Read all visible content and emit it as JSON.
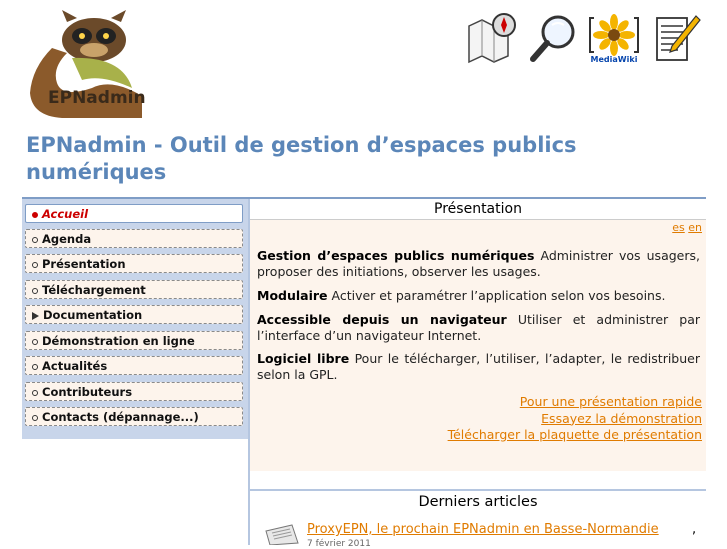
{
  "header": {
    "logo_text": "EPNadmin",
    "icons": [
      "map-compass-icon",
      "magnifier-icon",
      "mediawiki-icon",
      "notepad-pencil-icon"
    ],
    "mediawiki_label": "MediaWiki"
  },
  "page": {
    "title": "EPNadmin - Outil de gestion d’espaces publics numériques"
  },
  "sidebar": {
    "items": [
      {
        "label": "Accueil",
        "active": true,
        "marker": "bullet"
      },
      {
        "label": "Agenda",
        "active": false,
        "marker": "bullet"
      },
      {
        "label": "Présentation",
        "active": false,
        "marker": "bullet"
      },
      {
        "label": "Téléchargement",
        "active": false,
        "marker": "bullet"
      },
      {
        "label": "Documentation",
        "active": false,
        "marker": "triangle"
      },
      {
        "label": "Démonstration en ligne",
        "active": false,
        "marker": "bullet"
      },
      {
        "label": "Actualités",
        "active": false,
        "marker": "bullet"
      },
      {
        "label": "Contributeurs",
        "active": false,
        "marker": "bullet"
      },
      {
        "label": "Contacts (dépannage...)",
        "active": false,
        "marker": "bullet"
      }
    ]
  },
  "presentation": {
    "title": "Présentation",
    "languages": [
      "es",
      "en"
    ],
    "paragraphs": [
      {
        "strong": "Gestion d’espaces publics numériques",
        "text": " Administrer vos usagers, proposer des initiations, observer les usages."
      },
      {
        "strong": "Modulaire",
        "text": " Activer et paramétrer l’application selon vos besoins."
      },
      {
        "strong": "Accessible depuis un navigateur",
        "text": " Utiliser et administrer par l’interface d’un navigateur Internet."
      },
      {
        "strong": "Logiciel libre",
        "text": " Pour le télécharger, l’utiliser, l’adapter, le redistribuer selon la GPL."
      }
    ],
    "links": [
      "Pour une présentation rapide",
      "Essayez la démonstration",
      "Télécharger la plaquette de présentation"
    ]
  },
  "articles": {
    "title": "Derniers articles",
    "items": [
      {
        "title": "ProxyEPN, le prochain EPNadmin en Basse-Normandie",
        "suffix": ",",
        "date": "7 février 2011"
      }
    ]
  },
  "colors": {
    "title_blue": "#5b86b8",
    "sidebar_bg": "#c8d5ea",
    "panel_bg": "#fdf4ec",
    "link_orange": "#e07b00",
    "active_red": "#cc0000"
  }
}
